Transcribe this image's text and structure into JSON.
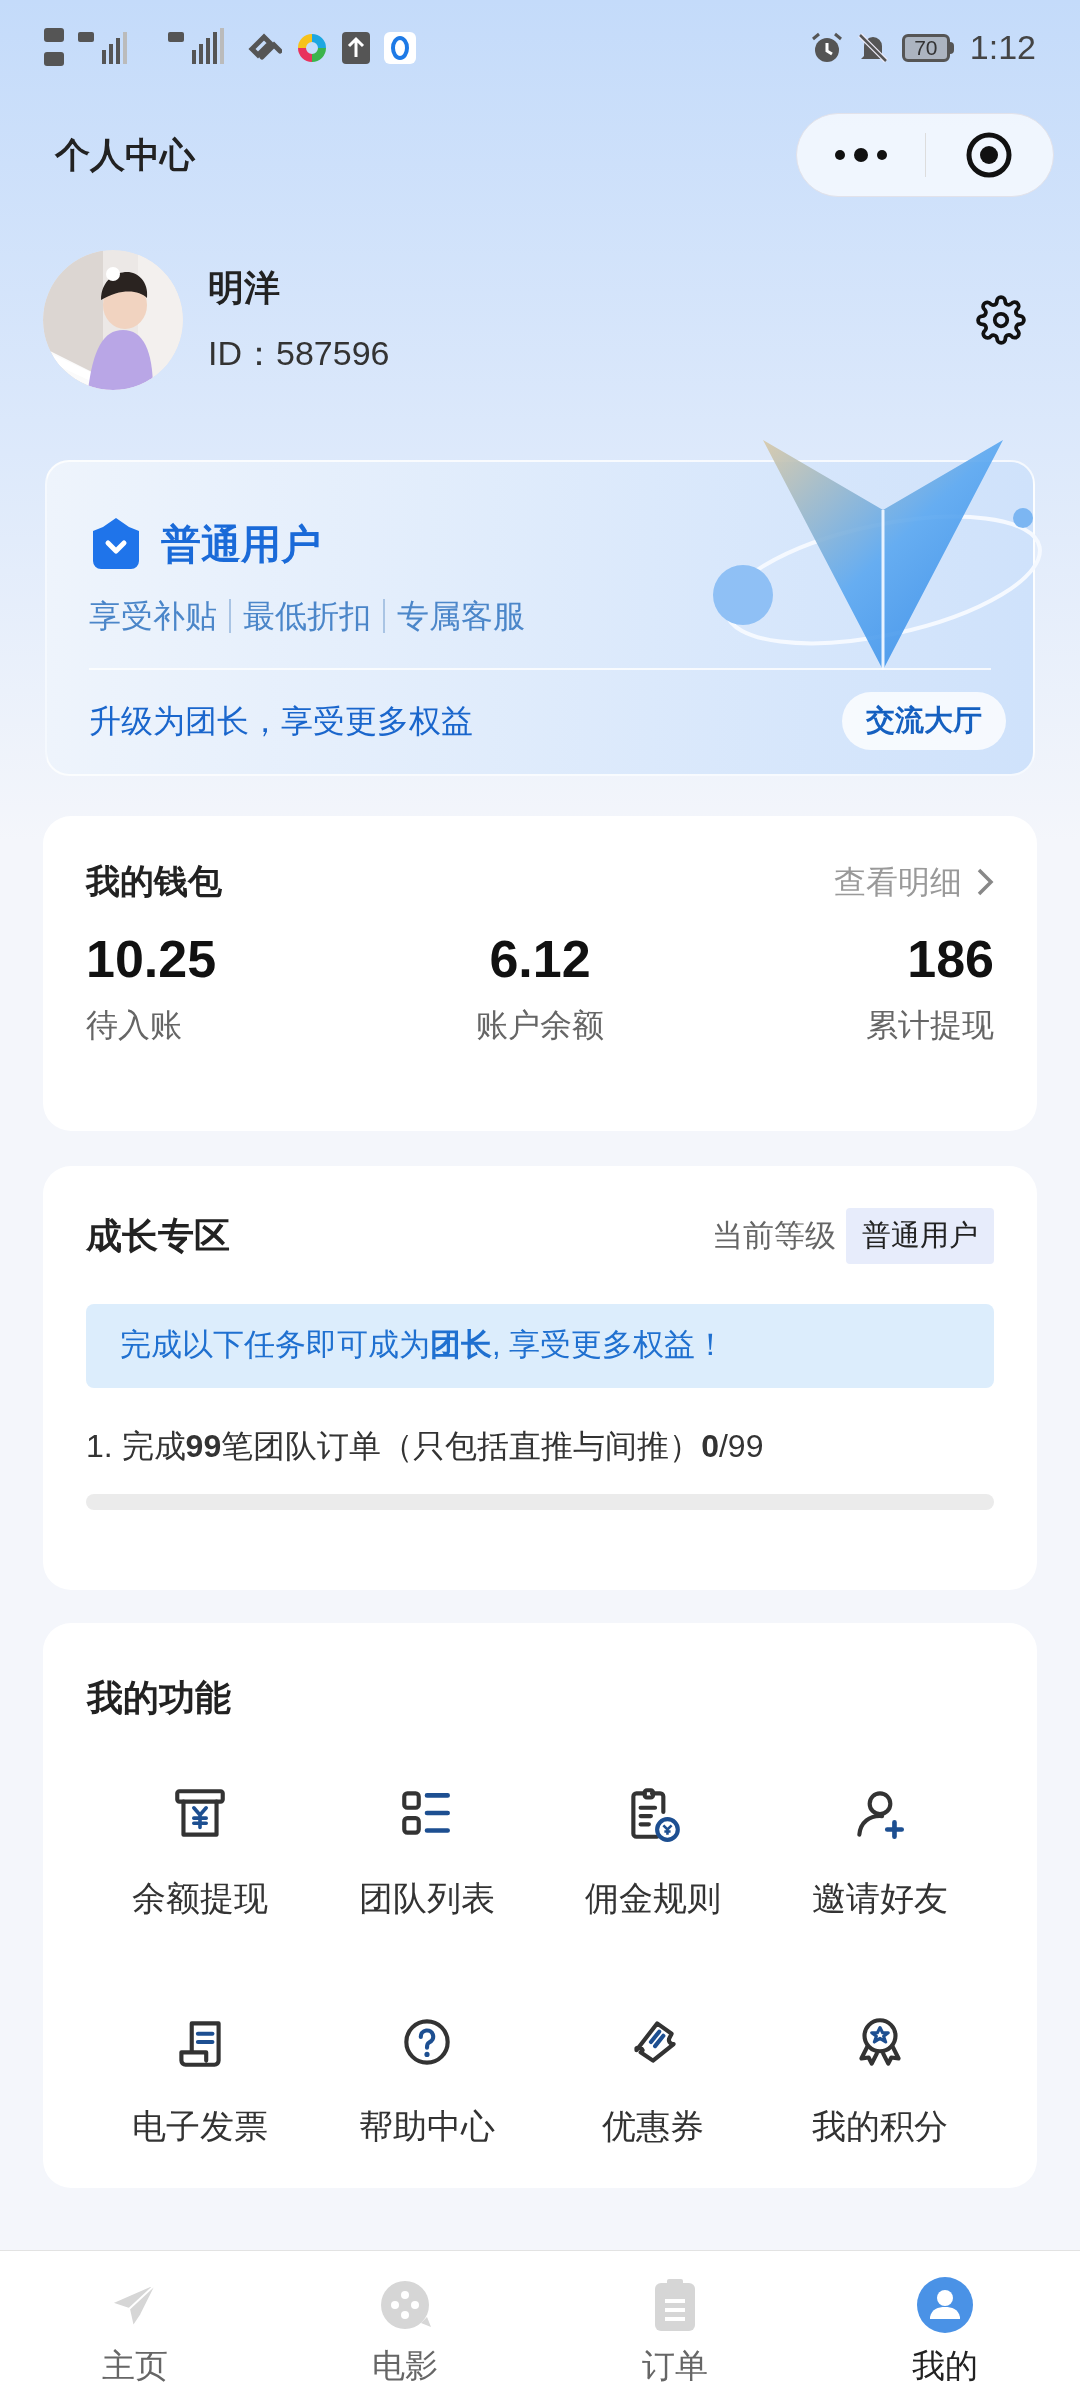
{
  "status_bar": {
    "battery": "70",
    "time": "1:12"
  },
  "header": {
    "title": "个人中心"
  },
  "profile": {
    "name": "明洋",
    "id": "ID：587596"
  },
  "member_card": {
    "level": "普通用户",
    "perks": [
      "享受补贴",
      "最低折扣",
      "专属客服"
    ],
    "upgrade_text": "升级为团长，享受更多权益",
    "button": "交流大厅"
  },
  "wallet": {
    "title": "我的钱包",
    "link": "查看明细",
    "stats": [
      {
        "value": "10.25",
        "label": "待入账"
      },
      {
        "value": "6.12",
        "label": "账户余额"
      },
      {
        "value": "186",
        "label": "累计提现"
      }
    ]
  },
  "growth": {
    "title": "成长专区",
    "level_label": "当前等级",
    "level": "普通用户",
    "notice": "完成以下任务即可成为**团长**, 享受更多权益！",
    "tasks": [
      {
        "text": "1. 完成**99**笔团队订单（只包括直推与间推）**0**/99",
        "level": 0
      }
    ]
  },
  "functions": {
    "title": "我的功能",
    "items": [
      {
        "label": "余额提现",
        "kind": "withdraw"
      },
      {
        "label": "团队列表",
        "kind": "list"
      },
      {
        "label": "佣金规则",
        "kind": "rules"
      },
      {
        "label": "邀请好友",
        "kind": "invite"
      },
      {
        "label": "电子发票",
        "kind": "invoice"
      },
      {
        "label": "帮助中心",
        "kind": "help"
      },
      {
        "label": "优惠券",
        "kind": "coupon"
      },
      {
        "label": "我的积分",
        "kind": "points"
      }
    ]
  },
  "tab_bar": {
    "items": [
      {
        "label": "主页",
        "kind": "home",
        "selected": false
      },
      {
        "label": "电影",
        "kind": "movie",
        "selected": false
      },
      {
        "label": "订单",
        "kind": "orders",
        "selected": false
      },
      {
        "label": "我的",
        "kind": "me",
        "selected": true
      }
    ]
  }
}
